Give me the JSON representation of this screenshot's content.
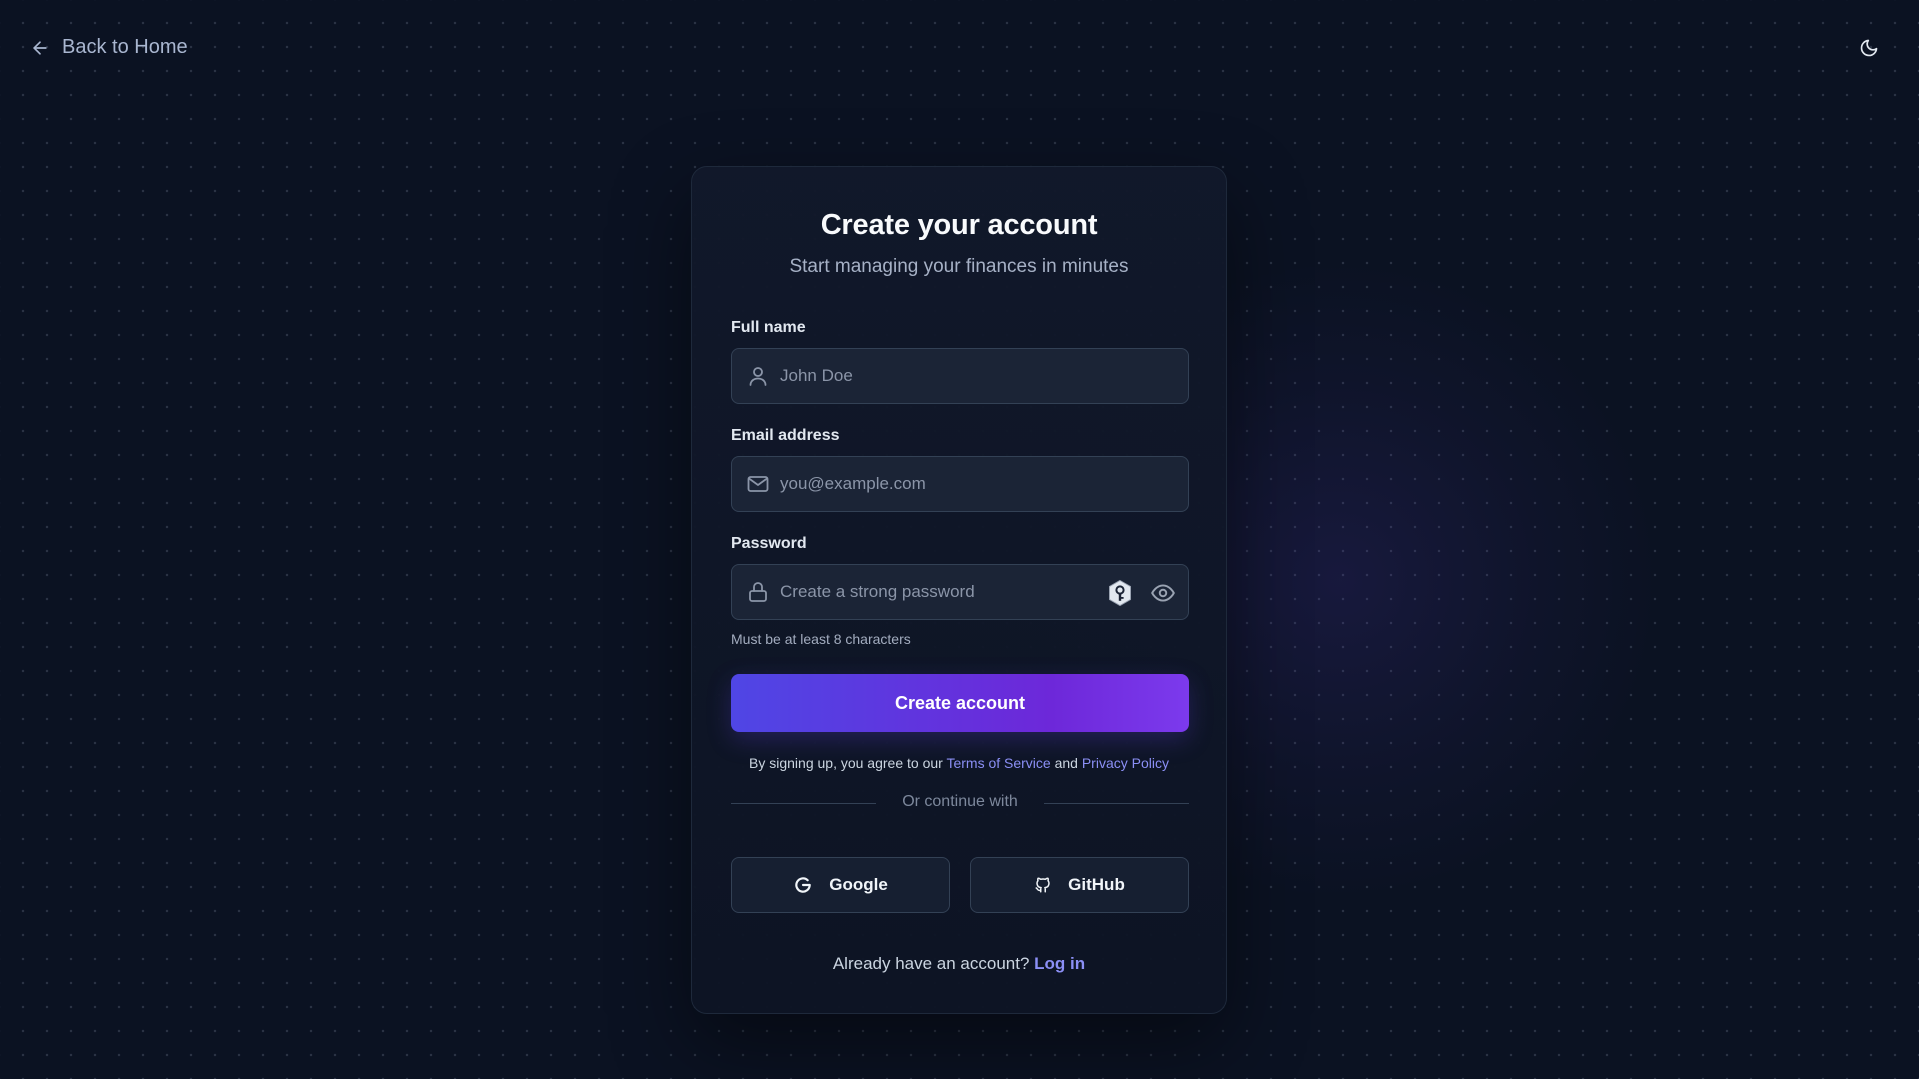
{
  "nav": {
    "back_label": "Back to Home"
  },
  "icons": {
    "back": "arrow-left-icon",
    "theme": "moon-icon",
    "name": "user-icon",
    "email": "mail-icon",
    "password": "lock-icon",
    "password_manager": "key-icon",
    "show_password": "eye-icon",
    "google": "google-icon",
    "github": "github-icon"
  },
  "signup": {
    "title": "Create your account",
    "subtitle": "Start managing your finances in minutes",
    "full_name": {
      "label": "Full name",
      "placeholder": "John Doe",
      "value": ""
    },
    "email": {
      "label": "Email address",
      "placeholder": "you@example.com",
      "value": ""
    },
    "password": {
      "label": "Password",
      "placeholder": "Create a strong password",
      "value": "",
      "hint": "Must be at least 8 characters"
    },
    "submit_label": "Create account",
    "terms": {
      "prefix": "By signing up, you agree to our ",
      "tos_link": "Terms of Service",
      "conjunction": " and ",
      "privacy_link": "Privacy Policy"
    },
    "divider_text": "Or continue with",
    "social": {
      "google_label": "Google",
      "github_label": "GitHub"
    },
    "login": {
      "prompt": "Already have an account? ",
      "link": "Log in"
    }
  },
  "colors": {
    "background": "#0b1222",
    "card": "#11182a",
    "accent_start": "#4f46e5",
    "accent_end": "#7c3aed",
    "link": "#8b8ff5"
  }
}
